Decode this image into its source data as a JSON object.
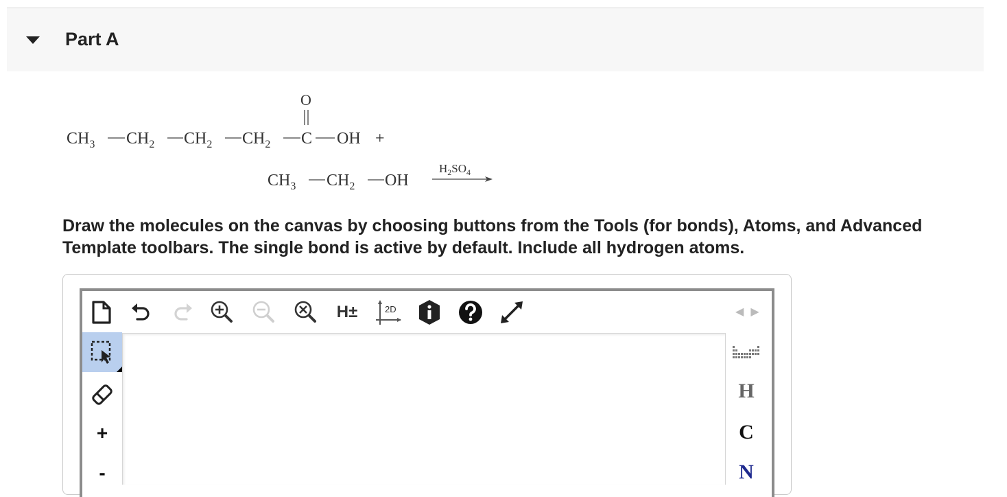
{
  "part": {
    "title": "Part A"
  },
  "reaction": {
    "acid": {
      "carbonyl_o": "O",
      "chain": [
        "CH",
        "CH",
        "CH",
        "CH",
        "C"
      ],
      "subscripts": [
        "3",
        "2",
        "2",
        "2"
      ],
      "oh": "OH",
      "plus": "+"
    },
    "alcohol": {
      "chain": [
        "CH",
        "CH"
      ],
      "subscripts": [
        "3",
        "2"
      ],
      "oh": "OH"
    },
    "catalyst": {
      "prefix": "H",
      "sub1": "2",
      "mid": "SO",
      "sub2": "4"
    }
  },
  "instructions": "Draw the molecules on the canvas by choosing buttons from the Tools (for bonds), Atoms, and Advanced Template toolbars. The single bond is active by default. Include all hydrogen atoms.",
  "toolbar": {
    "hydrogens_label": "H±",
    "clean2d_label": "2D"
  },
  "left_toolbar": {
    "plus_label": "+",
    "minus_label": "-"
  },
  "atoms": {
    "h": "H",
    "c": "C",
    "n": "N"
  },
  "colors": {
    "header_bg": "#f7f7f7",
    "active_tool": "#b9cfee",
    "nitrogen": "#1f2a8f",
    "hydrogen": "#666666"
  }
}
